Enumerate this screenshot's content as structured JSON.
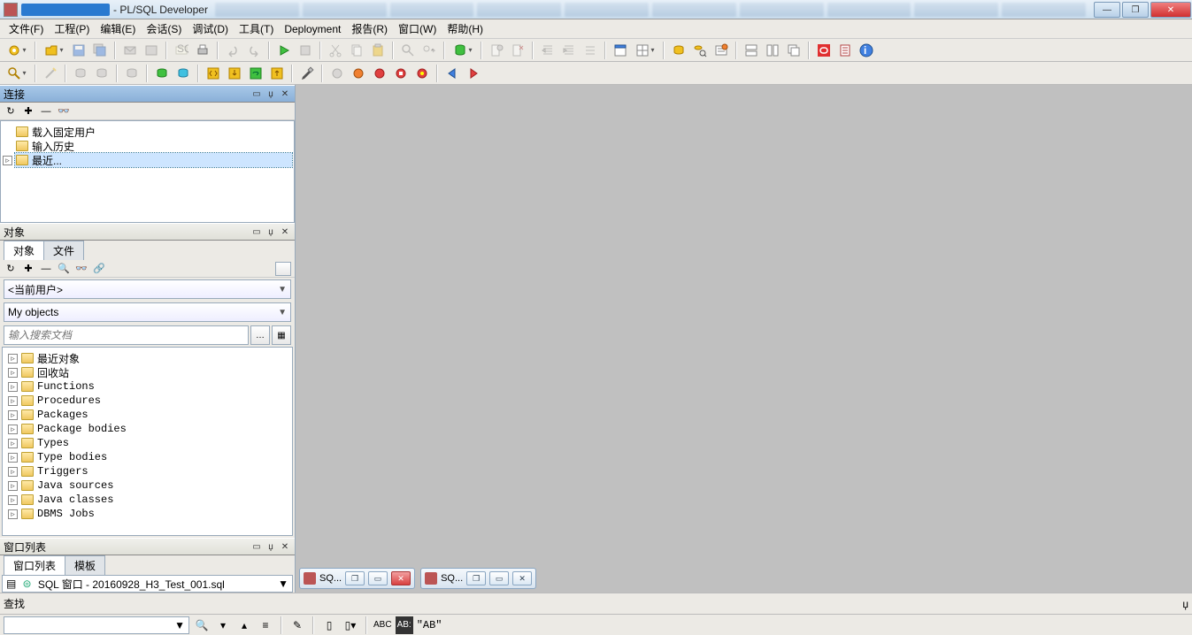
{
  "title": " - PL/SQL Developer",
  "menu": [
    "文件(F)",
    "工程(P)",
    "编辑(E)",
    "会话(S)",
    "调试(D)",
    "工具(T)",
    "Deployment",
    "报告(R)",
    "窗口(W)",
    "帮助(H)"
  ],
  "panels": {
    "conn_title": "连接",
    "obj_title": "对象",
    "winlist_title": "窗口列表",
    "find_title": "查找"
  },
  "conn_tree": [
    {
      "label": "载入固定用户",
      "exp": ""
    },
    {
      "label": "输入历史",
      "exp": ""
    },
    {
      "label": "最近...",
      "exp": "▹",
      "sel": true
    }
  ],
  "obj_tabs": [
    "对象",
    "文件"
  ],
  "obj_scope": "<当前用户>",
  "obj_group": "My objects",
  "obj_search_ph": "输入搜索文档",
  "obj_tree": [
    "最近对象",
    "回收站",
    "Functions",
    "Procedures",
    "Packages",
    "Package bodies",
    "Types",
    "Type bodies",
    "Triggers",
    "Java sources",
    "Java classes",
    "DBMS Jobs"
  ],
  "winlist_tabs": [
    "窗口列表",
    "模板"
  ],
  "winlist_item": "SQL 窗口 - 20160928_H3_Test_001.sql",
  "mdi_tasks": [
    {
      "label": "SQ..."
    },
    {
      "label": "SQ..."
    }
  ],
  "status_quote": "\"AB\""
}
